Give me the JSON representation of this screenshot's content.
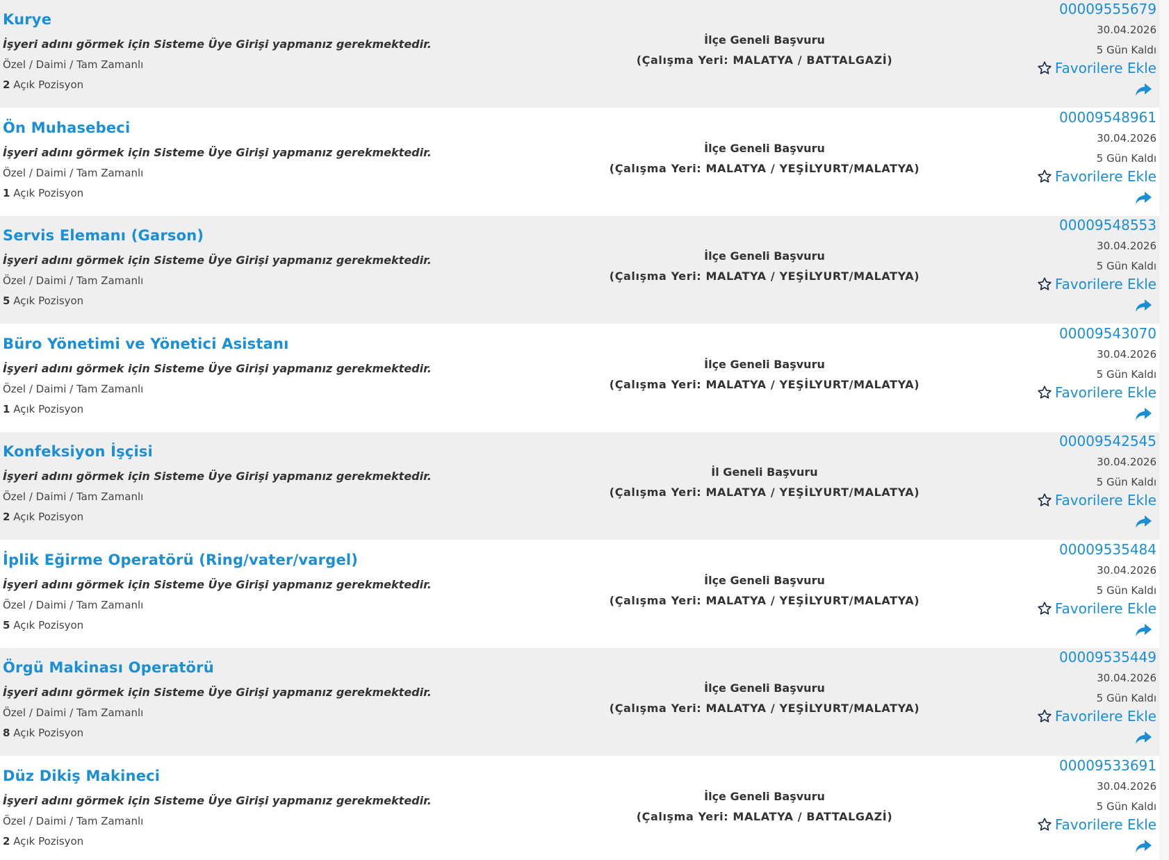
{
  "labels": {
    "employer_notice": "İşyeri adını görmek için Sisteme Üye Girişi yapmanız gerekmektedir.",
    "job_type": "Özel / Daimi / Tam Zamanlı",
    "positions_suffix": "Açık Pozisyon",
    "favorite": "Favorilere Ekle"
  },
  "colors": {
    "link": "#1a8fd6",
    "row_alt": "#efefef",
    "text": "#333333"
  },
  "jobs": [
    {
      "title": "Kurye",
      "positions": "2",
      "apply_scope": "İlçe Geneli Başvuru",
      "workplace": "(Çalışma Yeri: MALATYA / BATTALGAZİ)",
      "ilan_no": "00009555679",
      "date": "30.04.2026",
      "days_left": "5 Gün Kaldı"
    },
    {
      "title": "Ön Muhasebeci",
      "positions": "1",
      "apply_scope": "İlçe Geneli Başvuru",
      "workplace": "(Çalışma Yeri: MALATYA / YEŞİLYURT/MALATYA)",
      "ilan_no": "00009548961",
      "date": "30.04.2026",
      "days_left": "5 Gün Kaldı"
    },
    {
      "title": "Servis Elemanı (Garson)",
      "positions": "5",
      "apply_scope": "İlçe Geneli Başvuru",
      "workplace": "(Çalışma Yeri: MALATYA / YEŞİLYURT/MALATYA)",
      "ilan_no": "00009548553",
      "date": "30.04.2026",
      "days_left": "5 Gün Kaldı"
    },
    {
      "title": "Büro Yönetimi ve Yönetici Asistanı",
      "positions": "1",
      "apply_scope": "İlçe Geneli Başvuru",
      "workplace": "(Çalışma Yeri: MALATYA / YEŞİLYURT/MALATYA)",
      "ilan_no": "00009543070",
      "date": "30.04.2026",
      "days_left": "5 Gün Kaldı"
    },
    {
      "title": "Konfeksiyon İşçisi",
      "positions": "2",
      "apply_scope": "İl Geneli Başvuru",
      "workplace": "(Çalışma Yeri: MALATYA / YEŞİLYURT/MALATYA)",
      "ilan_no": "00009542545",
      "date": "30.04.2026",
      "days_left": "5 Gün Kaldı"
    },
    {
      "title": "İplik Eğirme Operatörü (Ring/vater/vargel)",
      "positions": "5",
      "apply_scope": "İlçe Geneli Başvuru",
      "workplace": "(Çalışma Yeri: MALATYA / YEŞİLYURT/MALATYA)",
      "ilan_no": "00009535484",
      "date": "30.04.2026",
      "days_left": "5 Gün Kaldı"
    },
    {
      "title": "Örgü Makinası Operatörü",
      "positions": "8",
      "apply_scope": "İlçe Geneli Başvuru",
      "workplace": "(Çalışma Yeri: MALATYA / YEŞİLYURT/MALATYA)",
      "ilan_no": "00009535449",
      "date": "30.04.2026",
      "days_left": "5 Gün Kaldı"
    },
    {
      "title": "Düz Dikiş Makineci",
      "positions": "2",
      "apply_scope": "İlçe Geneli Başvuru",
      "workplace": "(Çalışma Yeri: MALATYA / BATTALGAZİ)",
      "ilan_no": "00009533691",
      "date": "30.04.2026",
      "days_left": "5 Gün Kaldı"
    }
  ]
}
